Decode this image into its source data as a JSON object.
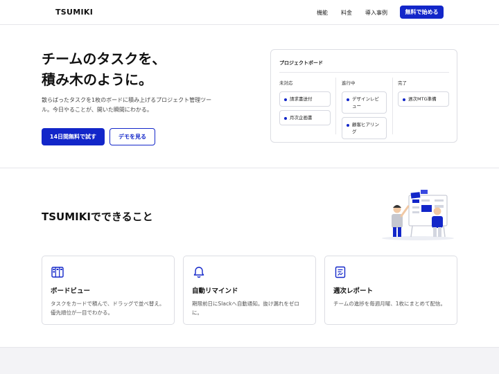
{
  "header": {
    "logo": "TSUMIKI",
    "nav": [
      "機能",
      "料金",
      "導入事例"
    ],
    "cta": "無料で始める"
  },
  "hero": {
    "title": "チームのタスクを、\n積み木のように。",
    "description": "散らばったタスクを1枚のボードに積み上げるプロジェクト管理ツール。今日やることが、開いた瞬間にわかる。",
    "primary_button": "14日間無料で試す",
    "secondary_button": "デモを見る"
  },
  "board": {
    "title": "プロジェクトボード",
    "columns": [
      {
        "name": "未対応",
        "tasks": [
          "請求書送付",
          "月次企画書"
        ]
      },
      {
        "name": "進行中",
        "tasks": [
          "デザインレビュー",
          "顧客ヒアリング"
        ]
      },
      {
        "name": "完了",
        "tasks": [
          "週次MTG準備"
        ]
      }
    ]
  },
  "features": {
    "title": "TSUMIKIでできること",
    "cards": [
      {
        "icon": "board-icon",
        "title": "ボードビュー",
        "text": "タスクをカードで積んで、ドラッグで並べ替え。優先順位が一目でわかる。"
      },
      {
        "icon": "bell-icon",
        "title": "自動リマインド",
        "text": "期限前日にSlackへ自動通知。抜け漏れをゼロに。"
      },
      {
        "icon": "report-icon",
        "title": "週次レポート",
        "text": "チームの進捗を毎週月曜、1枚にまとめて配信。"
      }
    ]
  },
  "colors": {
    "accent": "#1226c9",
    "border": "#dcdde3",
    "band": "#f3f3f6"
  }
}
